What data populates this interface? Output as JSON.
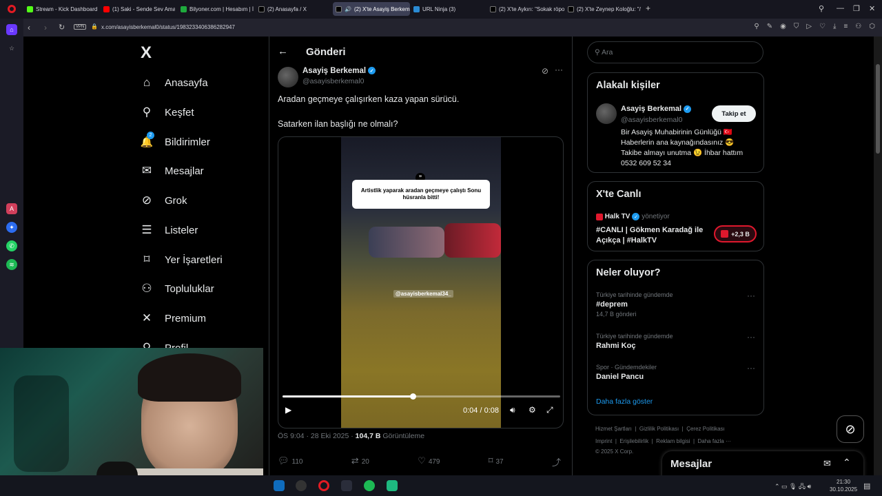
{
  "browser": {
    "tabs": [
      {
        "label": "Stream - Kick Dashboard",
        "fav": "k"
      },
      {
        "label": "(1) Saki - Sende Sev Ama",
        "fav": "yt"
      },
      {
        "label": "Bilyoner.com | Hesabım | İ",
        "fav": "b"
      },
      {
        "label": "(2) Anasayfa / X",
        "fav": "x"
      },
      {
        "label": "(2) X'te Asayiş Berkem",
        "fav": "x",
        "active": true
      },
      {
        "label": "URL Ninja (3)",
        "fav": "u"
      },
      {
        "label": "(2) X'te Aykırı: \"Sokak röpo",
        "fav": "x"
      },
      {
        "label": "(2) X'te Zeynep Koloğlu: \"/",
        "fav": "x"
      }
    ],
    "url": "x.com/asayisberkemal0/status/1983233406386282947",
    "vpn": "VPN"
  },
  "sidebar": {
    "logo": "X",
    "items": [
      {
        "label": "Anasayfa",
        "icon": "home-icon",
        "glyph": "⌂"
      },
      {
        "label": "Keşfet",
        "icon": "search-icon",
        "glyph": "⚲"
      },
      {
        "label": "Bildirimler",
        "icon": "bell-icon",
        "glyph": "🔔",
        "badge": "2"
      },
      {
        "label": "Mesajlar",
        "icon": "mail-icon",
        "glyph": "✉"
      },
      {
        "label": "Grok",
        "icon": "grok-icon",
        "glyph": "⊘"
      },
      {
        "label": "Listeler",
        "icon": "list-icon",
        "glyph": "☰"
      },
      {
        "label": "Yer İşaretleri",
        "icon": "bookmark-icon",
        "glyph": "⌑"
      },
      {
        "label": "Topluluklar",
        "icon": "communities-icon",
        "glyph": "⚇"
      },
      {
        "label": "Premium",
        "icon": "x-premium-icon",
        "glyph": "✕"
      },
      {
        "label": "Profil",
        "icon": "profile-icon",
        "glyph": "⚲"
      }
    ]
  },
  "post": {
    "header": "Gönderi",
    "author_name": "Asayiş Berkemal",
    "author_handle": "@asayisberkemal0",
    "text_line1": "Aradan geçmeye çalışırken kaza yapan sürücü.",
    "text_line2": "Satarken ilan başlığı ne olmalı?",
    "video_caption": "Artistlik yaparak aradan geçmeye çalıştı Sonu hüsranla bitti!",
    "video_watermark": "@asayisberkemal34_",
    "time_current": "0:04",
    "time_total": "0:08",
    "progress": 0.47,
    "meta_time": "ÖS 9:04 · 28 Eki 2025 · ",
    "views": "104,7 B",
    "views_label": " Görüntüleme",
    "replies": "110",
    "reposts": "20",
    "likes": "479",
    "bookmarks": "37"
  },
  "right": {
    "search_placeholder": "Ara",
    "related_title": "Alakalı kişiler",
    "related_name": "Asayiş Berkemal",
    "related_handle": "@asayisberkemal0",
    "follow_label": "Takip et",
    "bio_line1": "Bir Asayiş Muhabirinin Günlüğü 🇹🇷",
    "bio_line2": "Haberlerin ana kaynağındasınız 😎",
    "bio_line3": "Takibe almayı unutma 😉 İhbar hattım",
    "bio_line4": "0532 609 52 34",
    "live_title": "X'te Canlı",
    "live_host": "Halk TV",
    "live_role": "yönetiyor",
    "live_text_line1": "#CANLI | Gökmen Karadağ ile",
    "live_text_line2": "Açıkça | #HalkTV",
    "live_count": "+2,3 B",
    "trends_title": "Neler oluyor?",
    "trends": [
      {
        "context": "Türkiye tarihinde gündemde",
        "title": "#deprem",
        "count": "14,7 B gönderi"
      },
      {
        "context": "Türkiye tarihinde gündemde",
        "title": "Rahmi Koç",
        "count": ""
      },
      {
        "context": "Spor · Gündemdekiler",
        "title": "Daniel Pancu",
        "count": ""
      }
    ],
    "show_more": "Daha fazla göster",
    "footer_line1": [
      "Hizmet Şartları",
      "Gizlilik Politikası",
      "Çerez Politikası"
    ],
    "footer_line2": [
      "Imprint",
      "Erişilebilirlik",
      "Reklam bilgisi",
      "Daha fazla ···"
    ],
    "copyright": "© 2025 X Corp.",
    "messages_label": "Mesajlar"
  },
  "taskbar": {
    "time": "21:30",
    "date": "30.10.2025"
  },
  "colors": {
    "accent": "#1d9bf0",
    "background": "#000000",
    "border": "#2f3336",
    "muted": "#71767b"
  }
}
